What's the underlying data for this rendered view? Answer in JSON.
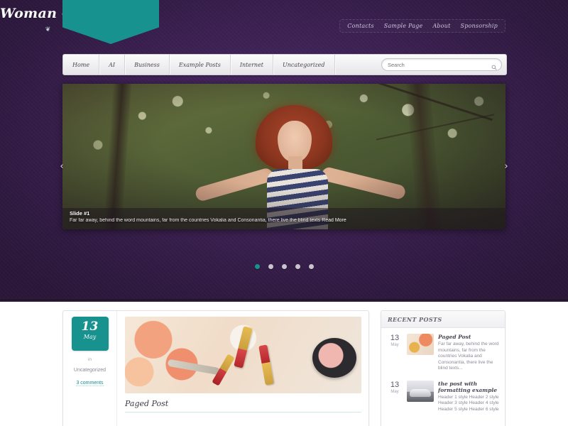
{
  "site": {
    "logo_text": "Woman Club",
    "logo_ornament": "❦"
  },
  "top_nav": {
    "items": [
      {
        "label": "Contacts"
      },
      {
        "label": "Sample Page"
      },
      {
        "label": "About"
      },
      {
        "label": "Sponsorship"
      }
    ]
  },
  "main_nav": {
    "items": [
      {
        "label": "Home"
      },
      {
        "label": "AI"
      },
      {
        "label": "Business"
      },
      {
        "label": "Example Posts"
      },
      {
        "label": "Internet"
      },
      {
        "label": "Uncategorized"
      }
    ]
  },
  "search": {
    "placeholder": "Search",
    "value": "",
    "icon": "search-icon"
  },
  "slider": {
    "prev_icon": "‹",
    "next_icon": "›",
    "caption_title": "Slide #1",
    "caption_text": "Far far away, behind the word mountains, far from the countries Vokalia and Consonantia, there live the blind texts",
    "read_more": "Read More",
    "dots": [
      {
        "active": true
      },
      {
        "active": false
      },
      {
        "active": false
      },
      {
        "active": false
      },
      {
        "active": false
      }
    ]
  },
  "post": {
    "date_day": "13",
    "date_month": "May",
    "in_label": "in",
    "category": "Uncategorized",
    "comments": "3 comments",
    "title": "Paged Post"
  },
  "sidebar": {
    "widget_title": "RECENT POSTS",
    "recent_posts": [
      {
        "day": "13",
        "month": "May",
        "title": "Paged Post",
        "excerpt": "Far far away, behind the word mountains, far from the countries Vokalia and Consonantia, there live the blind texts..."
      },
      {
        "day": "13",
        "month": "May",
        "title": "the post with formatting example",
        "excerpt": "Header 1 style Header 2 style Header 3 style Header 4 style Header 5 style Header 6 style"
      }
    ]
  },
  "colors": {
    "accent_teal": "#17928f",
    "header_purple": "#3d2153",
    "nav_light": "#f2f1f4"
  }
}
